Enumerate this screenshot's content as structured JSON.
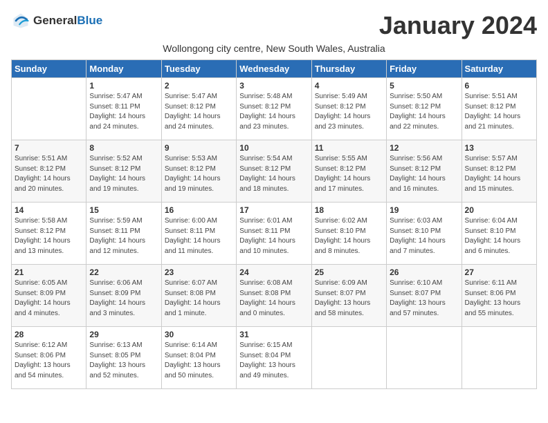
{
  "header": {
    "logo_general": "General",
    "logo_blue": "Blue",
    "month_title": "January 2024",
    "subtitle": "Wollongong city centre, New South Wales, Australia"
  },
  "days_of_week": [
    "Sunday",
    "Monday",
    "Tuesday",
    "Wednesday",
    "Thursday",
    "Friday",
    "Saturday"
  ],
  "weeks": [
    [
      {
        "day": "",
        "info": ""
      },
      {
        "day": "1",
        "info": "Sunrise: 5:47 AM\nSunset: 8:11 PM\nDaylight: 14 hours\nand 24 minutes."
      },
      {
        "day": "2",
        "info": "Sunrise: 5:47 AM\nSunset: 8:12 PM\nDaylight: 14 hours\nand 24 minutes."
      },
      {
        "day": "3",
        "info": "Sunrise: 5:48 AM\nSunset: 8:12 PM\nDaylight: 14 hours\nand 23 minutes."
      },
      {
        "day": "4",
        "info": "Sunrise: 5:49 AM\nSunset: 8:12 PM\nDaylight: 14 hours\nand 23 minutes."
      },
      {
        "day": "5",
        "info": "Sunrise: 5:50 AM\nSunset: 8:12 PM\nDaylight: 14 hours\nand 22 minutes."
      },
      {
        "day": "6",
        "info": "Sunrise: 5:51 AM\nSunset: 8:12 PM\nDaylight: 14 hours\nand 21 minutes."
      }
    ],
    [
      {
        "day": "7",
        "info": "Sunrise: 5:51 AM\nSunset: 8:12 PM\nDaylight: 14 hours\nand 20 minutes."
      },
      {
        "day": "8",
        "info": "Sunrise: 5:52 AM\nSunset: 8:12 PM\nDaylight: 14 hours\nand 19 minutes."
      },
      {
        "day": "9",
        "info": "Sunrise: 5:53 AM\nSunset: 8:12 PM\nDaylight: 14 hours\nand 19 minutes."
      },
      {
        "day": "10",
        "info": "Sunrise: 5:54 AM\nSunset: 8:12 PM\nDaylight: 14 hours\nand 18 minutes."
      },
      {
        "day": "11",
        "info": "Sunrise: 5:55 AM\nSunset: 8:12 PM\nDaylight: 14 hours\nand 17 minutes."
      },
      {
        "day": "12",
        "info": "Sunrise: 5:56 AM\nSunset: 8:12 PM\nDaylight: 14 hours\nand 16 minutes."
      },
      {
        "day": "13",
        "info": "Sunrise: 5:57 AM\nSunset: 8:12 PM\nDaylight: 14 hours\nand 15 minutes."
      }
    ],
    [
      {
        "day": "14",
        "info": "Sunrise: 5:58 AM\nSunset: 8:12 PM\nDaylight: 14 hours\nand 13 minutes."
      },
      {
        "day": "15",
        "info": "Sunrise: 5:59 AM\nSunset: 8:11 PM\nDaylight: 14 hours\nand 12 minutes."
      },
      {
        "day": "16",
        "info": "Sunrise: 6:00 AM\nSunset: 8:11 PM\nDaylight: 14 hours\nand 11 minutes."
      },
      {
        "day": "17",
        "info": "Sunrise: 6:01 AM\nSunset: 8:11 PM\nDaylight: 14 hours\nand 10 minutes."
      },
      {
        "day": "18",
        "info": "Sunrise: 6:02 AM\nSunset: 8:10 PM\nDaylight: 14 hours\nand 8 minutes."
      },
      {
        "day": "19",
        "info": "Sunrise: 6:03 AM\nSunset: 8:10 PM\nDaylight: 14 hours\nand 7 minutes."
      },
      {
        "day": "20",
        "info": "Sunrise: 6:04 AM\nSunset: 8:10 PM\nDaylight: 14 hours\nand 6 minutes."
      }
    ],
    [
      {
        "day": "21",
        "info": "Sunrise: 6:05 AM\nSunset: 8:09 PM\nDaylight: 14 hours\nand 4 minutes."
      },
      {
        "day": "22",
        "info": "Sunrise: 6:06 AM\nSunset: 8:09 PM\nDaylight: 14 hours\nand 3 minutes."
      },
      {
        "day": "23",
        "info": "Sunrise: 6:07 AM\nSunset: 8:08 PM\nDaylight: 14 hours\nand 1 minute."
      },
      {
        "day": "24",
        "info": "Sunrise: 6:08 AM\nSunset: 8:08 PM\nDaylight: 14 hours\nand 0 minutes."
      },
      {
        "day": "25",
        "info": "Sunrise: 6:09 AM\nSunset: 8:07 PM\nDaylight: 13 hours\nand 58 minutes."
      },
      {
        "day": "26",
        "info": "Sunrise: 6:10 AM\nSunset: 8:07 PM\nDaylight: 13 hours\nand 57 minutes."
      },
      {
        "day": "27",
        "info": "Sunrise: 6:11 AM\nSunset: 8:06 PM\nDaylight: 13 hours\nand 55 minutes."
      }
    ],
    [
      {
        "day": "28",
        "info": "Sunrise: 6:12 AM\nSunset: 8:06 PM\nDaylight: 13 hours\nand 54 minutes."
      },
      {
        "day": "29",
        "info": "Sunrise: 6:13 AM\nSunset: 8:05 PM\nDaylight: 13 hours\nand 52 minutes."
      },
      {
        "day": "30",
        "info": "Sunrise: 6:14 AM\nSunset: 8:04 PM\nDaylight: 13 hours\nand 50 minutes."
      },
      {
        "day": "31",
        "info": "Sunrise: 6:15 AM\nSunset: 8:04 PM\nDaylight: 13 hours\nand 49 minutes."
      },
      {
        "day": "",
        "info": ""
      },
      {
        "day": "",
        "info": ""
      },
      {
        "day": "",
        "info": ""
      }
    ]
  ]
}
